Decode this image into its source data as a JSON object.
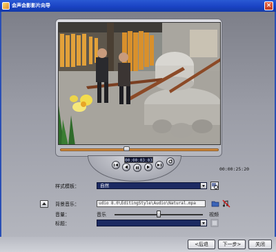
{
  "window": {
    "title": "会声会影影片向导",
    "close_label": "×"
  },
  "player": {
    "timecode": "00:00:03:03",
    "duration": "00:00:25:20",
    "progress": 0.42,
    "controls": [
      "go-to-start-icon",
      "previous-frame-icon",
      "play-icon",
      "next-frame-icon",
      "go-to-end-icon",
      "repeat-icon"
    ]
  },
  "form": {
    "template_label": "样式模板：",
    "template_value": "自然",
    "music_label": "背景音乐：",
    "music_path": "udio 8.0\\EditingStyle\\Audio\\Natural.mpa",
    "volume_label": "音量：",
    "volume_music": "音乐",
    "volume_video": "视频",
    "volume_balance": 0.5,
    "title_label": "标题：",
    "title_value": ""
  },
  "buttons": {
    "back": "<后退",
    "next": "下一步>",
    "close": "关闭"
  },
  "colors": {
    "titlebar": "#1a43c4",
    "combo_bg": "#1c2a62",
    "seek_track": "#d28a3c"
  }
}
